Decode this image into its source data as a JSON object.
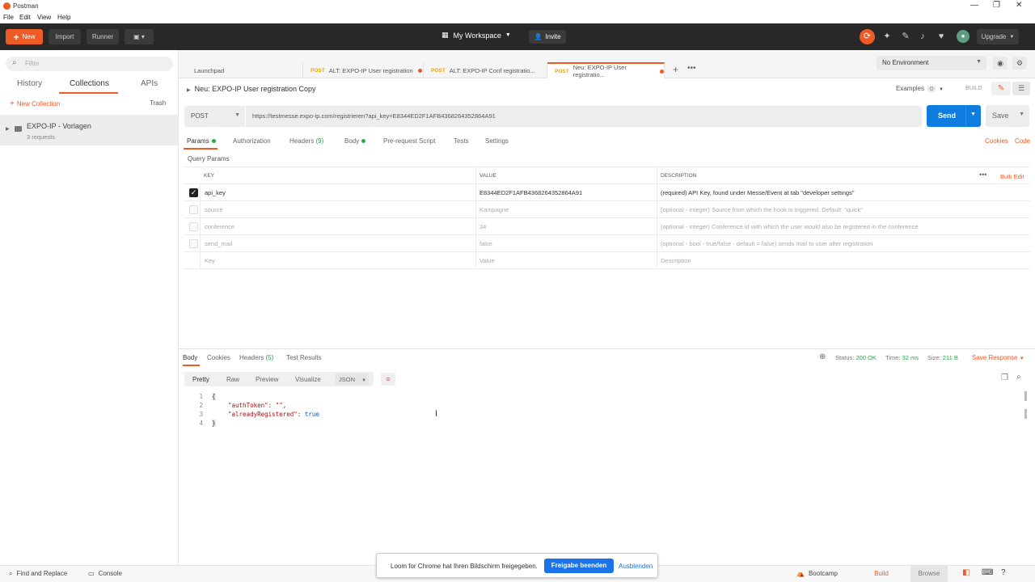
{
  "window": {
    "title": "Postman",
    "minimize": "—",
    "maximize": "❐",
    "close": "✕"
  },
  "menu": [
    "File",
    "Edit",
    "View",
    "Help"
  ],
  "header": {
    "new_label": "New",
    "import_label": "Import",
    "runner_label": "Runner",
    "workspace_label": "My Workspace",
    "invite_label": "Invite",
    "upgrade_label": "Upgrade"
  },
  "sidebar": {
    "filter_placeholder": "Filter",
    "tabs": [
      "History",
      "Collections",
      "APIs"
    ],
    "new_collection": "New Collection",
    "trash": "Trash",
    "collection": {
      "name": "EXPO-IP - Vorlagen",
      "count": "3 requests"
    }
  },
  "tabs": [
    {
      "label": "Launchpad",
      "method": ""
    },
    {
      "label": "ALT: EXPO-IP User registration",
      "method": "POST"
    },
    {
      "label": "ALT: EXPO-IP Conf registratio...",
      "method": "POST"
    },
    {
      "label": "Neu: EXPO-IP User registratio...",
      "method": "POST"
    }
  ],
  "environment": {
    "selected": "No Environment"
  },
  "request": {
    "name": "Neu: EXPO-IP User registration Copy",
    "examples_label": "Examples",
    "examples_count": "0",
    "build_label": "BUILD",
    "method": "POST",
    "url": "https://testmesse.expo-ip.com/registrieren?api_key=E8344ED2F1AFB4368264352864A91",
    "send_label": "Send",
    "save_label": "Save"
  },
  "request_tabs": {
    "params": "Params",
    "authorization": "Authorization",
    "headers": "Headers",
    "headers_count": "(9)",
    "body": "Body",
    "prerequest": "Pre-request Script",
    "tests": "Tests",
    "settings": "Settings",
    "cookies": "Cookies",
    "code": "Code"
  },
  "params": {
    "section_label": "Query Params",
    "columns": {
      "key": "KEY",
      "value": "VALUE",
      "description": "DESCRIPTION"
    },
    "bulk_edit": "Bulk Edit",
    "rows": [
      {
        "key": "api_key",
        "value": "E8344ED2F1AFB4368264352864A91",
        "description": "(required) API Key, found under Messe/Event at tab \"developer settings\""
      },
      {
        "key": "source",
        "value": "Kampagne",
        "description": "(optional - integer) Source from which the hook is triggered. Default: \"quick\""
      },
      {
        "key": "conference",
        "value": "34",
        "description": "(optional - integer) Conference id with which the user would also be registered in the conference"
      },
      {
        "key": "send_mail",
        "value": "false",
        "description": "(optional - bool - true/false - default = false) sends mail to user after registration"
      }
    ],
    "placeholders": {
      "key": "Key",
      "value": "Value",
      "description": "Description"
    }
  },
  "response": {
    "tabs": {
      "body": "Body",
      "cookies": "Cookies",
      "headers": "Headers",
      "headers_count": "(5)",
      "test_results": "Test Results"
    },
    "status_label": "Status:",
    "status_value": "200 OK",
    "time_label": "Time:",
    "time_value": "32 ms",
    "size_label": "Size:",
    "size_value": "211 B",
    "save_response": "Save Response",
    "views": [
      "Pretty",
      "Raw",
      "Preview",
      "Visualize"
    ],
    "format": "JSON",
    "lines": [
      {
        "num": "1",
        "text": "{"
      },
      {
        "num": "2",
        "key": "\"authToken\"",
        "sep": ": ",
        "val": "\"\"",
        "end": ","
      },
      {
        "num": "3",
        "key": "\"alreadyRegistered\"",
        "sep": ": ",
        "bool": "true"
      },
      {
        "num": "4",
        "text": "}"
      }
    ]
  },
  "statusbar": {
    "find_replace": "Find and Replace",
    "console": "Console",
    "bootcamp": "Bootcamp",
    "build": "Build",
    "browse": "Browse"
  },
  "loom": {
    "message": "Loom for Chrome hat Ihren Bildschirm freigegeben.",
    "stop": "Freigabe beenden",
    "hide": "Ausblenden"
  },
  "colors": {
    "accent": "#ef5b25",
    "send": "#0f7ce0",
    "status_ok": "#2e9e48",
    "header_bg": "#282828"
  }
}
